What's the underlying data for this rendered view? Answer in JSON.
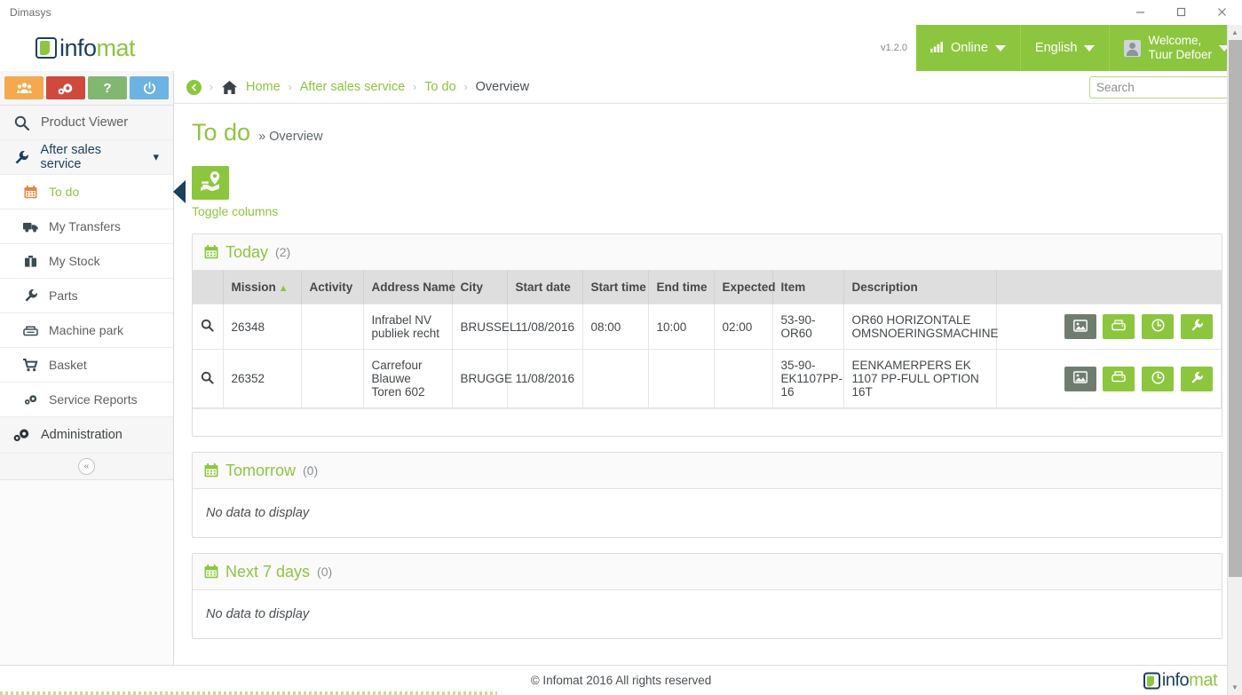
{
  "window": {
    "title": "Dimasys",
    "minimize_label": "Minimize",
    "maximize_label": "Maximize",
    "close_label": "Close"
  },
  "brand": {
    "logo_dark": "info",
    "logo_text": "mat",
    "version": "v1.2.0"
  },
  "header": {
    "online_label": "Online",
    "language_label": "English",
    "welcome_line1": "Welcome,",
    "welcome_line2": "Tuur Defoer"
  },
  "quickbar": {
    "items": [
      {
        "name": "users-button",
        "icon": "users-icon",
        "color": "#f5a94e"
      },
      {
        "name": "settings-button",
        "icon": "gears-icon",
        "color": "#cf4a3c"
      },
      {
        "name": "help-button",
        "icon": "question-icon",
        "color": "#82b772",
        "glyph": "?"
      },
      {
        "name": "power-button",
        "icon": "power-icon",
        "color": "#6cb3e2"
      }
    ]
  },
  "sidebar": {
    "items": [
      {
        "label": "Product Viewer",
        "icon": "search-icon",
        "level": "top"
      },
      {
        "label": "After sales service",
        "icon": "wrench-icon",
        "level": "section",
        "expanded": true
      },
      {
        "label": "To do",
        "icon": "calendar-icon",
        "level": "sub",
        "active": true
      },
      {
        "label": "My Transfers",
        "icon": "truck-icon",
        "level": "sub"
      },
      {
        "label": "My Stock",
        "icon": "briefcase-icon",
        "level": "sub"
      },
      {
        "label": "Parts",
        "icon": "wrench-icon",
        "level": "sub"
      },
      {
        "label": "Machine park",
        "icon": "machine-icon",
        "level": "sub"
      },
      {
        "label": "Basket",
        "icon": "cart-icon",
        "level": "sub"
      },
      {
        "label": "Service Reports",
        "icon": "gears-icon",
        "level": "sub"
      },
      {
        "label": "Administration",
        "icon": "gears-icon",
        "level": "admin"
      }
    ],
    "collapse_label": "«"
  },
  "breadcrumb": {
    "back_label": "‹",
    "home_label": "Home",
    "item2": "After sales service",
    "item3": "To do",
    "current": "Overview",
    "separator": "›"
  },
  "search": {
    "placeholder": "Search",
    "value": ""
  },
  "page": {
    "title": "To do",
    "subtitle": "» Overview",
    "toggle_columns_label": "Toggle columns"
  },
  "columns": [
    "Mission",
    "Activity",
    "Address Name",
    "City",
    "Start date",
    "Start time",
    "End time",
    "Expected",
    "Item",
    "Description"
  ],
  "sections": [
    {
      "title": "Today",
      "count": "(2)",
      "has_rows": true,
      "rows": [
        {
          "mission": "26348",
          "activity": "",
          "address_name": "Infrabel NV publiek recht",
          "city": "BRUSSEL",
          "start_date": "11/08/2016",
          "start_time": "08:00",
          "end_time": "10:00",
          "expected": "02:00",
          "item": "53-90-OR60",
          "description": "OR60 HORIZONTALE OMSNOERINGSMACHINE"
        },
        {
          "mission": "26352",
          "activity": "",
          "address_name": "Carrefour Blauwe Toren 602",
          "city": "BRUGGE",
          "start_date": "11/08/2016",
          "start_time": "",
          "end_time": "",
          "expected": "",
          "item": "35-90-EK1107PP-16",
          "description": "EENKAMERPERS EK 1107 PP-FULL OPTION 16T"
        }
      ]
    },
    {
      "title": "Tomorrow",
      "count": "(0)",
      "has_rows": false,
      "empty_text": "No data to display"
    },
    {
      "title": "Next 7 days",
      "count": "(0)",
      "has_rows": false,
      "empty_text": "No data to display"
    }
  ],
  "row_actions": [
    {
      "name": "photo-action-button",
      "icon": "image-icon",
      "style": "gray"
    },
    {
      "name": "print-action-button",
      "icon": "printer-icon",
      "style": "green"
    },
    {
      "name": "time-action-button",
      "icon": "clock-icon",
      "style": "green"
    },
    {
      "name": "service-action-button",
      "icon": "wrench-icon",
      "style": "green"
    }
  ],
  "footer": {
    "text": "© Infomat 2016 All rights reserved",
    "logo_dark": "info",
    "logo_text": "mat"
  },
  "colors": {
    "brand_green": "#8cc63e",
    "brand_navy": "#1b3f5e",
    "header_gray": "#dedede",
    "accent_orange": "#e8843c"
  }
}
